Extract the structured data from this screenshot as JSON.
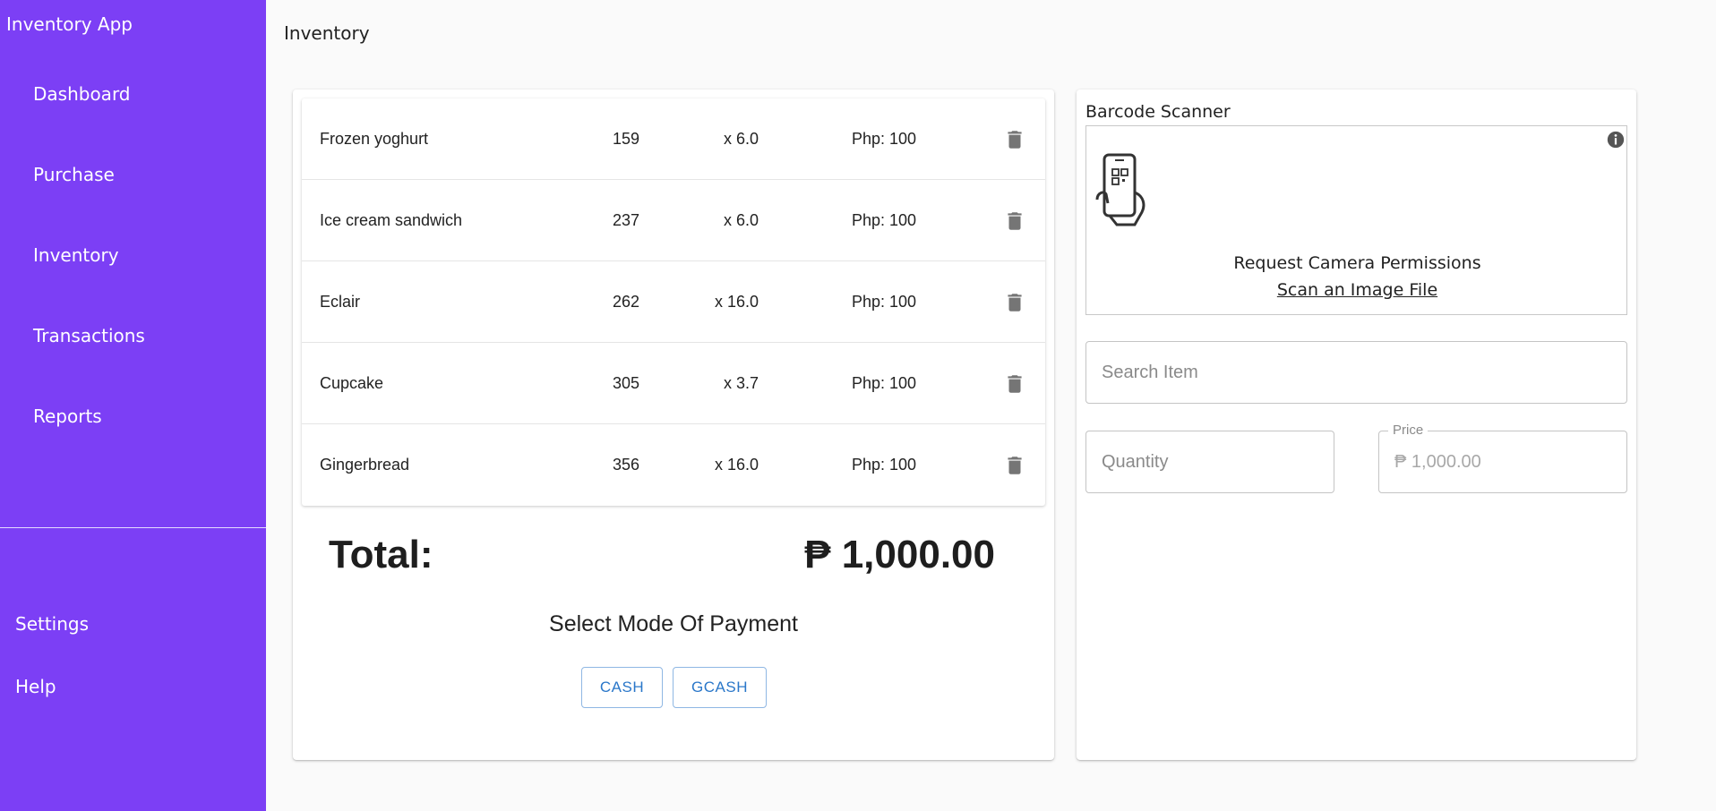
{
  "app": {
    "title": "Inventory App"
  },
  "sidebar": {
    "items": [
      {
        "label": "Dashboard"
      },
      {
        "label": "Purchase"
      },
      {
        "label": "Inventory"
      },
      {
        "label": "Transactions"
      },
      {
        "label": "Reports"
      }
    ],
    "bottom_items": [
      {
        "label": "Settings"
      },
      {
        "label": "Help"
      }
    ],
    "background_color": "#7c3ff5"
  },
  "page": {
    "title": "Inventory"
  },
  "cart": {
    "items": [
      {
        "name": "Frozen yoghurt",
        "qty": "159",
        "multiplier": "x 6.0",
        "price": "Php: 100"
      },
      {
        "name": "Ice cream sandwich",
        "qty": "237",
        "multiplier": "x 6.0",
        "price": "Php: 100"
      },
      {
        "name": "Eclair",
        "qty": "262",
        "multiplier": "x 16.0",
        "price": "Php: 100"
      },
      {
        "name": "Cupcake",
        "qty": "305",
        "multiplier": "x 3.7",
        "price": "Php: 100"
      },
      {
        "name": "Gingerbread",
        "qty": "356",
        "multiplier": "x 16.0",
        "price": "Php: 100"
      }
    ],
    "delete_icon": "trash-icon",
    "total_label": "Total:",
    "total_value": "₱ 1,000.00",
    "payment_label": "Select Mode Of Payment",
    "payment_buttons": {
      "cash": "CASH",
      "gcash": "GCASH"
    }
  },
  "scanner": {
    "title": "Barcode Scanner",
    "permission_text": "Request Camera Permissions",
    "scan_file_link": "Scan an Image File",
    "icons": {
      "info": "info-icon",
      "phone": "phone-qr-icon"
    }
  },
  "form": {
    "search": {
      "placeholder": "Search Item",
      "value": ""
    },
    "quantity": {
      "placeholder": "Quantity",
      "value": ""
    },
    "price": {
      "label": "Price",
      "placeholder": "₱ 1,000.00",
      "value": ""
    }
  }
}
